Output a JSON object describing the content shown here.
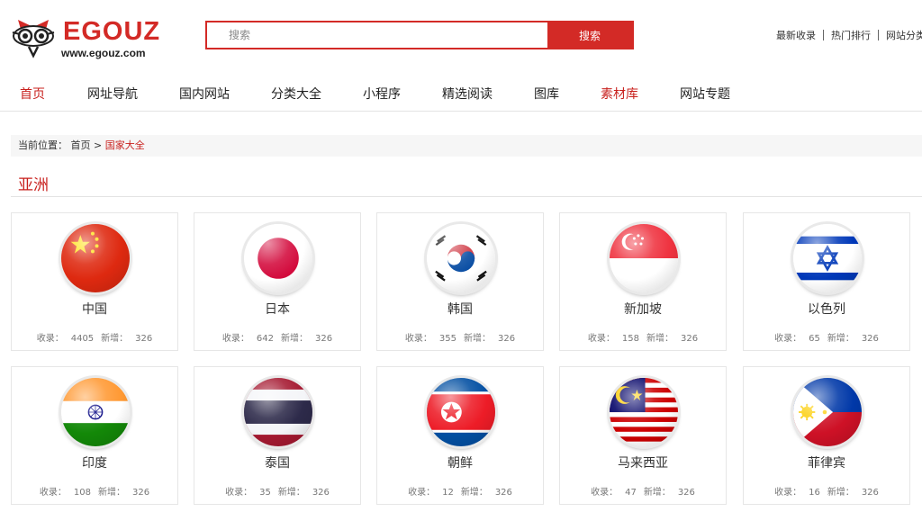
{
  "header": {
    "logo_text": "EGOUZ",
    "logo_url": "www.egouz.com",
    "search_placeholder": "搜索",
    "search_button": "搜索",
    "top_links": [
      "最新收录",
      "热门排行",
      "网站分类"
    ]
  },
  "nav": {
    "items": [
      {
        "label": "首页"
      },
      {
        "label": "网址导航"
      },
      {
        "label": "国内网站"
      },
      {
        "label": "分类大全"
      },
      {
        "label": "小程序"
      },
      {
        "label": "精选阅读"
      },
      {
        "label": "图库"
      },
      {
        "label": "素材库"
      },
      {
        "label": "网站专题"
      }
    ]
  },
  "breadcrumb": {
    "prefix": "当前位置：",
    "home": "首页",
    "separator": ">",
    "current": "国家大全"
  },
  "section": {
    "title": "亚洲"
  },
  "stat_labels": {
    "count": "收录：",
    "new": "新增："
  },
  "countries": [
    {
      "name": "中国",
      "count": "4405",
      "new": "326",
      "flag": "cn"
    },
    {
      "name": "日本",
      "count": "642",
      "new": "326",
      "flag": "jp"
    },
    {
      "name": "韩国",
      "count": "355",
      "new": "326",
      "flag": "kr"
    },
    {
      "name": "新加坡",
      "count": "158",
      "new": "326",
      "flag": "sg"
    },
    {
      "name": "以色列",
      "count": "65",
      "new": "326",
      "flag": "il"
    },
    {
      "name": "印度",
      "count": "108",
      "new": "326",
      "flag": "in"
    },
    {
      "name": "泰国",
      "count": "35",
      "new": "326",
      "flag": "th"
    },
    {
      "name": "朝鲜",
      "count": "12",
      "new": "326",
      "flag": "kp"
    },
    {
      "name": "马来西亚",
      "count": "47",
      "new": "326",
      "flag": "my"
    },
    {
      "name": "菲律宾",
      "count": "16",
      "new": "326",
      "flag": "ph"
    }
  ],
  "colors": {
    "brand_red": "#d32a26",
    "nav_active": "#c8201d"
  }
}
